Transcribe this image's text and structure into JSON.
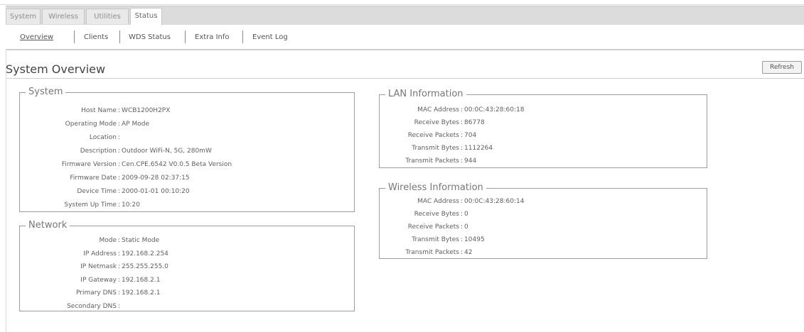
{
  "tabs": [
    {
      "label": "System",
      "active": false
    },
    {
      "label": "Wireless",
      "active": false
    },
    {
      "label": "Utilities",
      "active": false
    },
    {
      "label": "Status",
      "active": true
    }
  ],
  "subnav": [
    {
      "label": "Overview",
      "active": true
    },
    {
      "label": "Clients",
      "active": false
    },
    {
      "label": "WDS Status",
      "active": false
    },
    {
      "label": "Extra Info",
      "active": false
    },
    {
      "label": "Event Log",
      "active": false
    }
  ],
  "page": {
    "title": "System Overview",
    "refresh_label": "Refresh"
  },
  "panels": {
    "system": {
      "legend": "System",
      "rows": [
        {
          "label": "Host Name",
          "value": "WCB1200H2PX"
        },
        {
          "label": "Operating Mode",
          "value": "AP Mode"
        },
        {
          "label": "Location",
          "value": ""
        },
        {
          "label": "Description",
          "value": "Outdoor WiFi-N, 5G, 280mW"
        },
        {
          "label": "Firmware Version",
          "value": "Cen.CPE.6542 V0.0.5 Beta Version"
        },
        {
          "label": "Firmware Date",
          "value": "2009-09-28 02:37:15"
        },
        {
          "label": "Device Time",
          "value": "2000-01-01 00:10:20"
        },
        {
          "label": "System Up Time",
          "value": "10:20"
        }
      ]
    },
    "network": {
      "legend": "Network",
      "rows": [
        {
          "label": "Mode",
          "value": "Static Mode"
        },
        {
          "label": "IP Address",
          "value": "192.168.2.254"
        },
        {
          "label": "IP Netmask",
          "value": "255.255.255.0"
        },
        {
          "label": "IP Gateway",
          "value": "192.168.2.1"
        },
        {
          "label": "Primary DNS",
          "value": "192.168.2.1"
        },
        {
          "label": "Secondary DNS",
          "value": ""
        }
      ]
    },
    "lan": {
      "legend": "LAN Information",
      "rows": [
        {
          "label": "MAC Address",
          "value": "00:0C:43:28:60:18"
        },
        {
          "label": "Receive Bytes",
          "value": "86778"
        },
        {
          "label": "Receive Packets",
          "value": "704"
        },
        {
          "label": "Transmit Bytes",
          "value": "1112264"
        },
        {
          "label": "Transmit Packets",
          "value": "944"
        }
      ]
    },
    "wireless": {
      "legend": "Wireless Information",
      "rows": [
        {
          "label": "MAC Address",
          "value": "00:0C:43:28:60:14"
        },
        {
          "label": "Receive Bytes",
          "value": "0"
        },
        {
          "label": "Receive Packets",
          "value": "0"
        },
        {
          "label": "Transmit Bytes",
          "value": "10495"
        },
        {
          "label": "Transmit Packets",
          "value": "42"
        }
      ]
    }
  }
}
